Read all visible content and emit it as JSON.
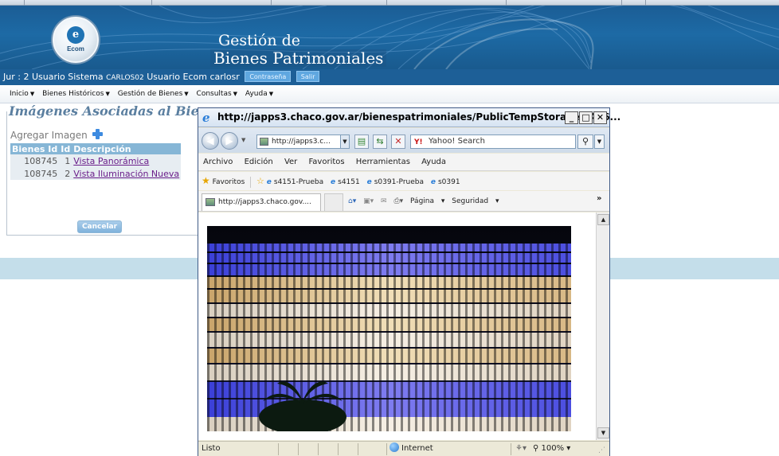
{
  "header": {
    "logo_text": "Ecom",
    "title_line1": "Gestión de",
    "title_line2": "Bienes Patrimoniales"
  },
  "userbar": {
    "jur_label": "Jur :",
    "jur_value": "2",
    "user_label": "Usuario Sistema",
    "user_value": "CARLOS02",
    "ecom_label": "Usuario Ecom",
    "ecom_value": "carlosr",
    "password_button": "Contraseña",
    "exit_button": "Salir"
  },
  "menu": {
    "items": [
      {
        "label": "Inicio"
      },
      {
        "label": "Bienes Históricos"
      },
      {
        "label": "Gestión de Bienes"
      },
      {
        "label": "Consultas"
      },
      {
        "label": "Ayuda"
      }
    ]
  },
  "panel": {
    "title": "Imágenes Asociadas al Bien",
    "add_label": "Agregar Imagen",
    "columns": [
      "Bienes Id",
      "Id",
      "Descripción"
    ],
    "rows": [
      {
        "bien_id": "108745",
        "id": "1",
        "desc": "Vista Panorámica"
      },
      {
        "bien_id": "108745",
        "id": "2",
        "desc": "Vista Iluminación Nueva"
      }
    ],
    "cancel_label": "Cancelar"
  },
  "popup": {
    "title": "http://japps3.chaco.gov.ar/bienespatrimoniales/PublicTempStorage/5436...",
    "address": "http://japps3.c...",
    "search_placeholder": "Yahoo! Search",
    "search_logo": "Y!",
    "menu": [
      "Archivo",
      "Edición",
      "Ver",
      "Favoritos",
      "Herramientas",
      "Ayuda"
    ],
    "favorites_label": "Favoritos",
    "favorites": [
      "s4151-Prueba",
      "s4151",
      "s0391-Prueba",
      "s0391"
    ],
    "tab_label": "http://japps3.chaco.gov....",
    "cmd_page": "Página",
    "cmd_security": "Seguridad",
    "status_text": "Listo",
    "status_zone": "Internet",
    "status_zoom": "100%"
  },
  "icons": {
    "back": "back-arrow-icon",
    "forward": "forward-arrow-icon",
    "refresh": "refresh-icon",
    "stop": "stop-icon",
    "search": "magnifier-icon",
    "home": "home-icon",
    "feeds": "rss-icon",
    "mail": "mail-icon",
    "print": "printer-icon",
    "add_image": "plus-icon"
  },
  "colors": {
    "header_blue": "#1d6aa5",
    "userbar_blue": "#1d5f97",
    "table_header": "#86b6d6",
    "link_purple": "#6a1e8a",
    "title_blue": "#5b7fa0"
  }
}
